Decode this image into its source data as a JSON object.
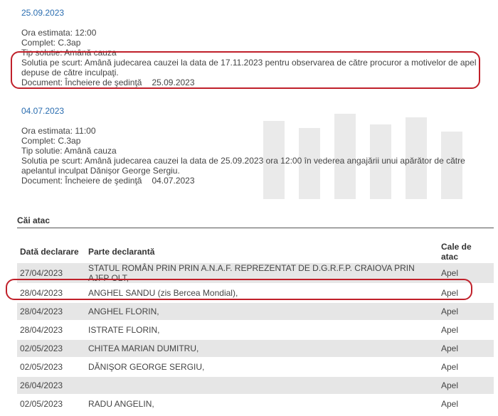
{
  "sessions": [
    {
      "date": "25.09.2023",
      "ora_label": "Ora estimata:",
      "ora": "12:00",
      "complet_label": "Complet:",
      "complet": "C.3ap",
      "tip_label": "Tip solutie:",
      "tip": "Amână cauza",
      "solutia_label": "Solutia pe scurt:",
      "solutia_1": "Amână judecarea cauzei la data de 17.11.2023 pentru observarea de către procuror a motivelor de apel",
      "solutia_2": "depuse de către inculpaţi.",
      "document_label": "Document:",
      "document": "Încheiere de şedinţă",
      "document_date": "25.09.2023"
    },
    {
      "date": "04.07.2023",
      "ora_label": "Ora estimata:",
      "ora": "11:00",
      "complet_label": "Complet:",
      "complet": "C.3ap",
      "tip_label": "Tip solutie:",
      "tip": "Amână cauza",
      "solutia_label": "Solutia pe scurt:",
      "solutia_1": "Amână judecarea cauzei la data de 25.09.2023 ora 12:00 în vederea angajării unui apărător de către",
      "solutia_2": "apelantul inculpat Dănişor George Sergiu.",
      "document_label": "Document:",
      "document": "Încheiere de şedinţă",
      "document_date": "04.07.2023"
    }
  ],
  "cai_atac": {
    "title": "Căi atac",
    "headers": [
      "Dată declarare",
      "Parte declarantă",
      "Cale de atac"
    ],
    "rows": [
      [
        "27/04/2023",
        "STATUL ROMÂN PRIN PRIN A.N.A.F. REPREZENTAT DE D.G.R.F.P. CRAIOVA PRIN AJFP OLT,",
        "Apel"
      ],
      [
        "28/04/2023",
        "ANGHEL SANDU (zis Bercea Mondial),",
        "Apel"
      ],
      [
        "28/04/2023",
        "ANGHEL FLORIN,",
        "Apel"
      ],
      [
        "28/04/2023",
        "ISTRATE FLORIN,",
        "Apel"
      ],
      [
        "02/05/2023",
        "CHITEA MARIAN DUMITRU,",
        "Apel"
      ],
      [
        "02/05/2023",
        "DĂNIŞOR GEORGE SERGIU,",
        "Apel"
      ],
      [
        "26/04/2023",
        "",
        "Apel"
      ],
      [
        "02/05/2023",
        "RADU ANGELIN,",
        "Apel"
      ]
    ]
  },
  "colors": {
    "link": "#2a6db0",
    "highlight": "#c0202a",
    "row_shade": "#e6e6e6"
  }
}
